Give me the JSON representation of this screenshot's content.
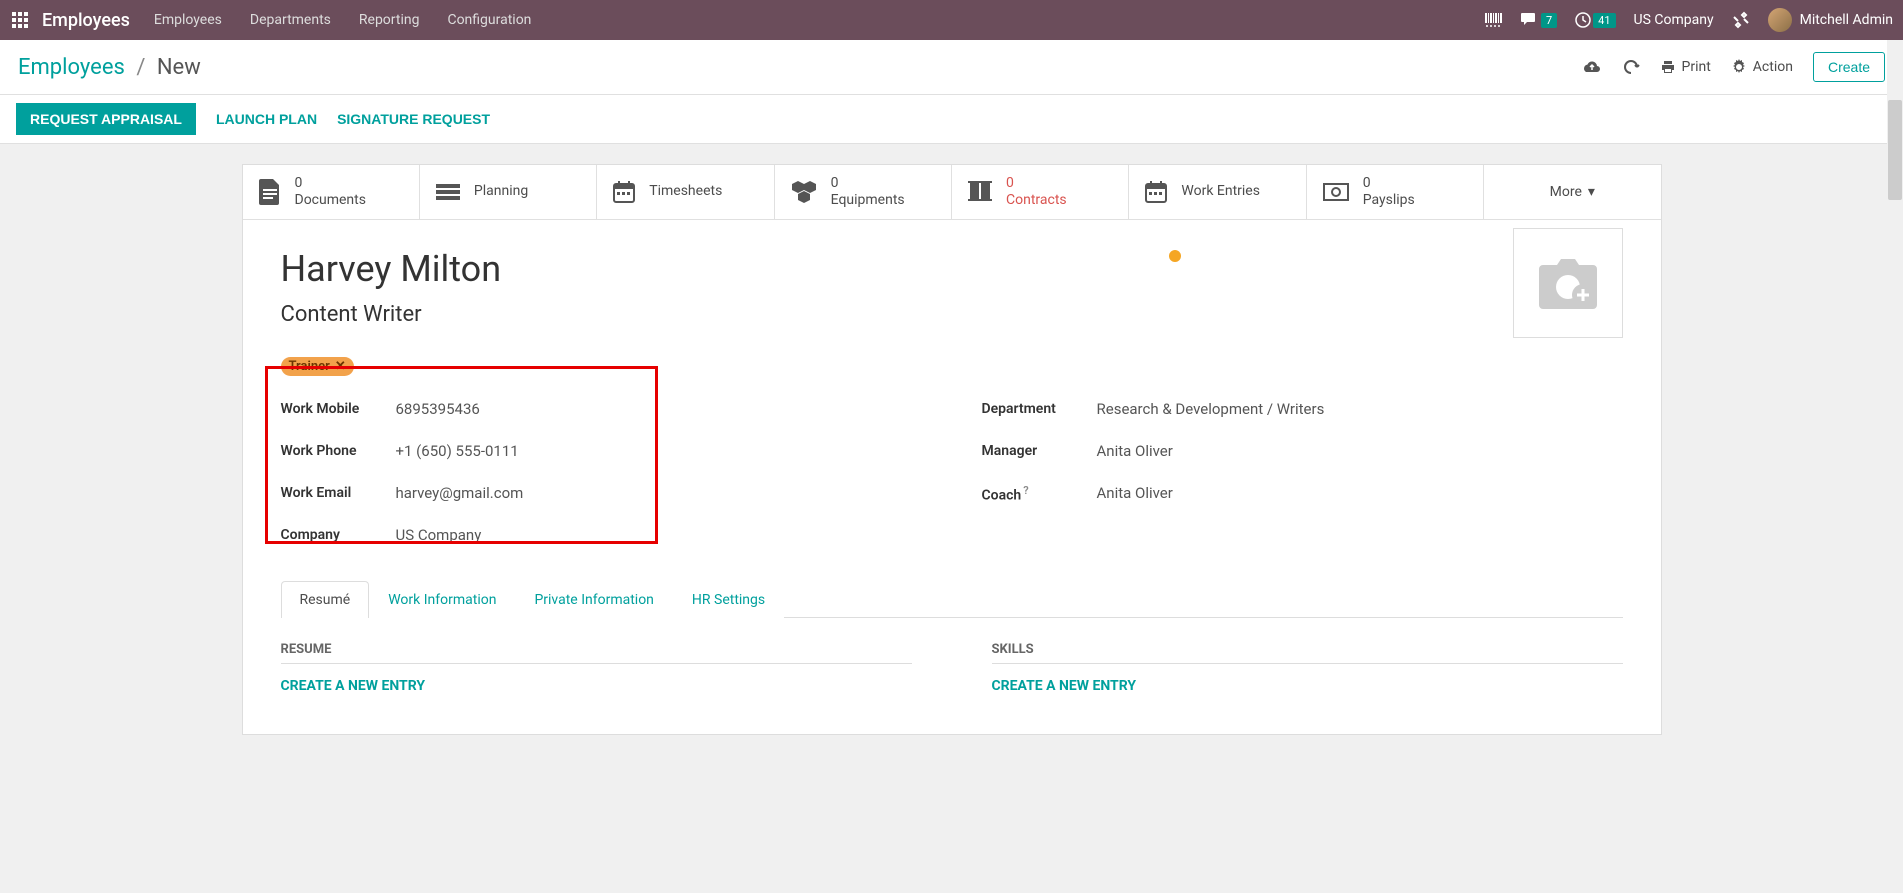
{
  "navbar": {
    "brand": "Employees",
    "menu": [
      "Employees",
      "Departments",
      "Reporting",
      "Configuration"
    ],
    "messages_badge": "7",
    "activities_badge": "41",
    "company": "US Company",
    "user": "Mitchell Admin"
  },
  "breadcrumb": {
    "root": "Employees",
    "current": "New"
  },
  "cp_buttons": {
    "print": "Print",
    "action": "Action",
    "create": "Create"
  },
  "statusbar": {
    "request_appraisal": "REQUEST APPRAISAL",
    "launch_plan": "LAUNCH PLAN",
    "signature_request": "SIGNATURE REQUEST"
  },
  "stat_buttons": [
    {
      "value": "0",
      "label": "Documents"
    },
    {
      "value": "",
      "label": "Planning"
    },
    {
      "value": "",
      "label": "Timesheets"
    },
    {
      "value": "0",
      "label": "Equipments"
    },
    {
      "value": "0",
      "label": "Contracts"
    },
    {
      "value": "",
      "label": "Work Entries"
    },
    {
      "value": "0",
      "label": "Payslips"
    },
    {
      "value": "",
      "label": "More"
    }
  ],
  "employee": {
    "name": "Harvey Milton",
    "job_title": "Content Writer",
    "tag": "Trainer"
  },
  "fields_left": {
    "work_mobile_label": "Work Mobile",
    "work_mobile": "6895395436",
    "work_phone_label": "Work Phone",
    "work_phone": "+1 (650) 555-0111",
    "work_email_label": "Work Email",
    "work_email": "harvey@gmail.com",
    "company_label": "Company",
    "company": "US Company"
  },
  "fields_right": {
    "department_label": "Department",
    "department": "Research & Development / Writers",
    "manager_label": "Manager",
    "manager": "Anita Oliver",
    "coach_label": "Coach",
    "coach": "Anita Oliver"
  },
  "tabs": {
    "resume": "Resumé",
    "work_info": "Work Information",
    "private_info": "Private Information",
    "hr_settings": "HR Settings"
  },
  "tab_content": {
    "resume_title": "RESUME",
    "skills_title": "SKILLS",
    "create_entry": "CREATE A NEW ENTRY"
  }
}
